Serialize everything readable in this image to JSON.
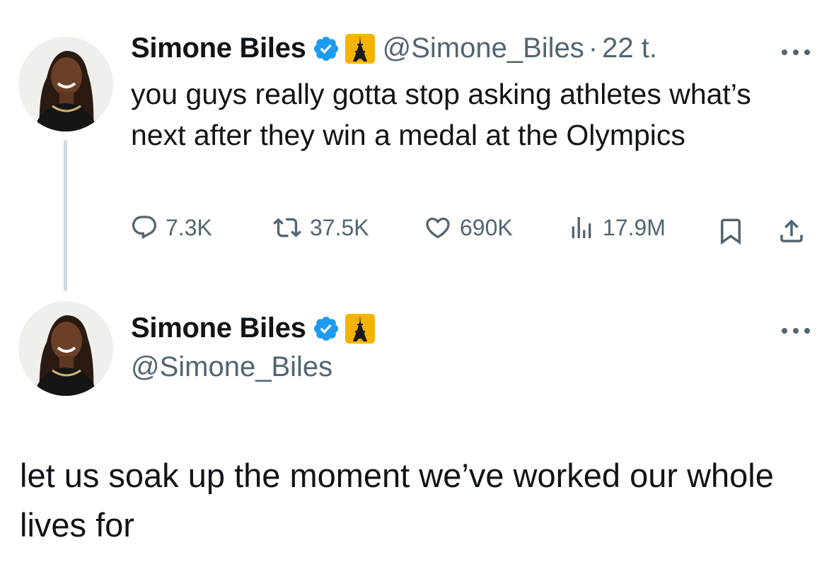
{
  "tweet1": {
    "display_name": "Simone Biles",
    "handle": "@Simone_Biles",
    "separator": "·",
    "time": "22 t.",
    "text": "you guys really gotta stop asking athletes what’s next after they win a medal at the Olympics",
    "replies": "7.3K",
    "reposts": "37.5K",
    "likes": "690K",
    "views": "17.9M"
  },
  "tweet2": {
    "display_name": "Simone Biles",
    "handle": "@Simone_Biles",
    "text": "let us soak up the moment we’ve worked our whole lives for"
  },
  "icons": {
    "verified": "verified-badge-icon",
    "affiliate": "eiffel-tower-badge-icon",
    "reply": "reply-icon",
    "repost": "repost-icon",
    "like": "heart-icon",
    "views": "views-chart-icon",
    "bookmark": "bookmark-icon",
    "share": "share-icon",
    "more": "more-dots-icon"
  },
  "colors": {
    "text": "#0f1419",
    "secondary": "#536471",
    "verified": "#1d9bf0",
    "badge": "#f5b400",
    "thread_line": "#cfd9de"
  }
}
